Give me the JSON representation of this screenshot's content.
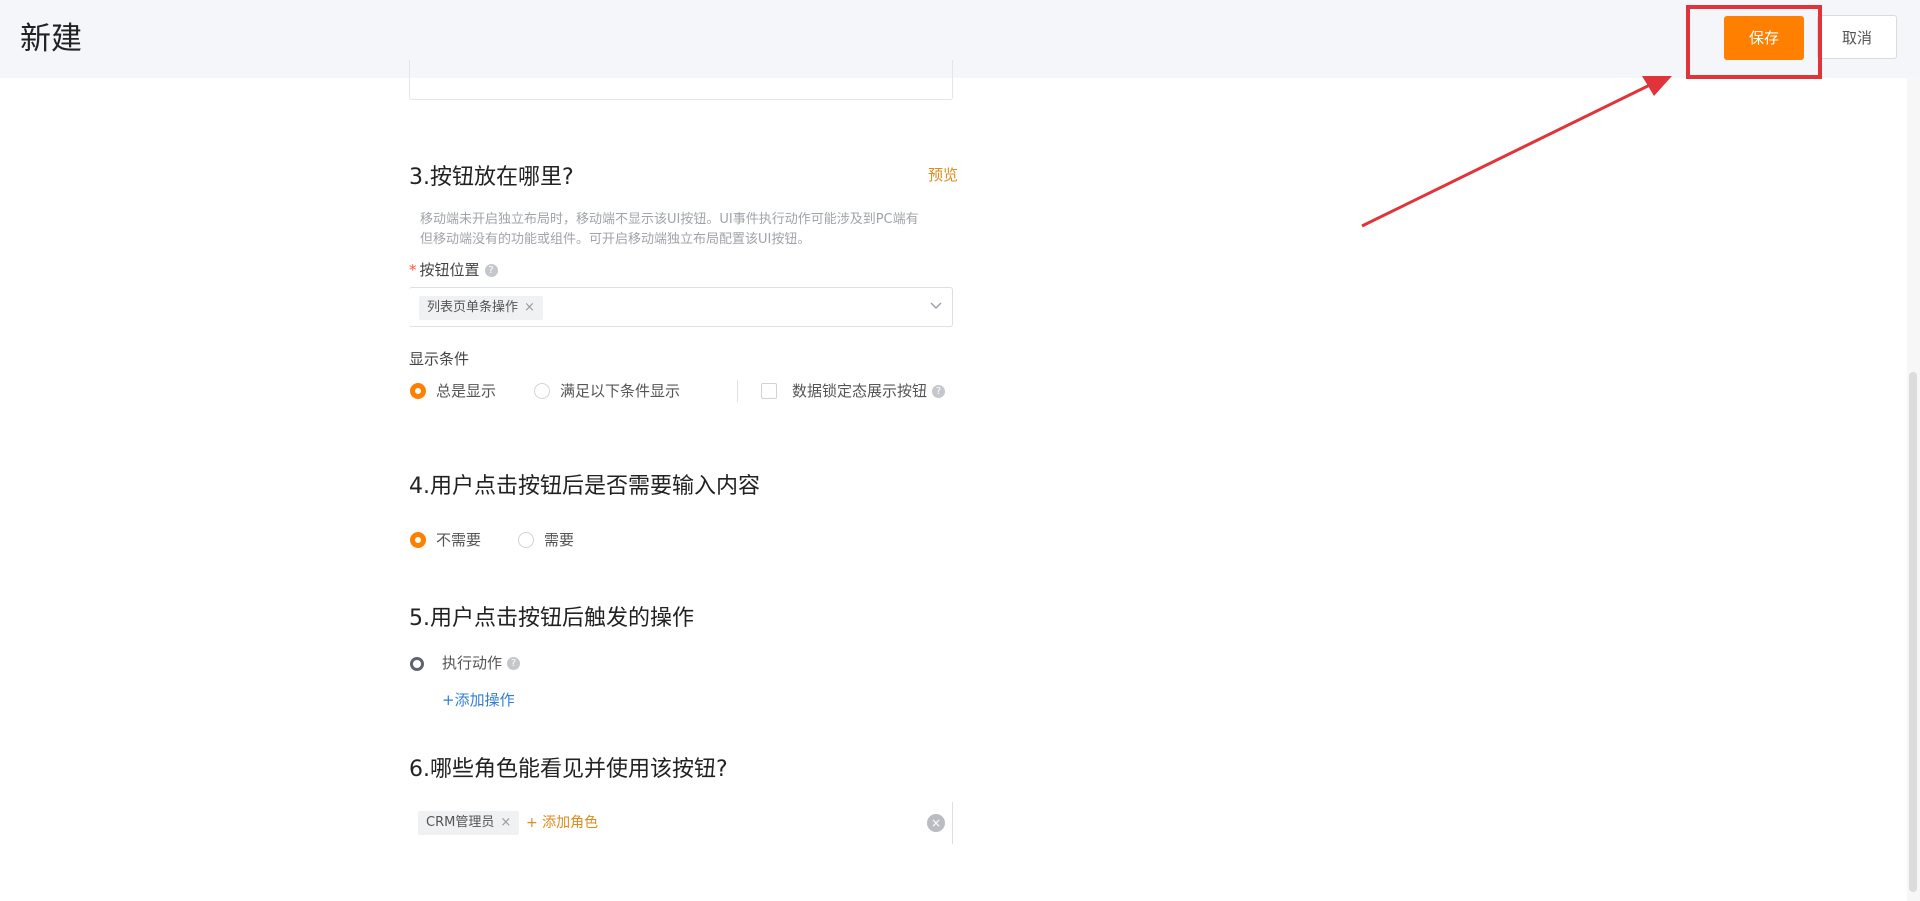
{
  "header": {
    "title": "新建",
    "save_label": "保存",
    "cancel_label": "取消"
  },
  "section3": {
    "title": "3.按钮放在哪里?",
    "preview_label": "预览",
    "hint_line1": "移动端未开启独立布局时，移动端不显示该UI按钮。UI事件执行动作可能涉及到PC端有",
    "hint_line2": "但移动端没有的功能或组件。可开启移动端独立布局配置该UI按钮。",
    "position_label": "按钮位置",
    "position_tag": "列表页单条操作",
    "display_condition_label": "显示条件",
    "options": [
      "总是显示",
      "满足以下条件显示"
    ],
    "selected_option": "总是显示",
    "lock_checkbox_label": "数据锁定态展示按钮"
  },
  "section4": {
    "title": "4.用户点击按钮后是否需要输入内容",
    "options": [
      "不需要",
      "需要"
    ],
    "selected_option": "不需要"
  },
  "section5": {
    "title": "5.用户点击按钮后触发的操作",
    "action_label": "执行动作",
    "add_action_label": "+添加操作"
  },
  "section6": {
    "title": "6.哪些角色能看见并使用该按钮?",
    "role_tag": "CRM管理员",
    "add_role_label": "+ 添加角色"
  },
  "icons": {
    "tag_remove": "close-icon",
    "select_dropdown": "chevron-down-icon",
    "help": "question-mark-icon",
    "clear": "clear-icon"
  },
  "colors": {
    "accent": "#ff8000",
    "link_blue": "#2f7fd8",
    "annotation_red": "#e0343a"
  }
}
